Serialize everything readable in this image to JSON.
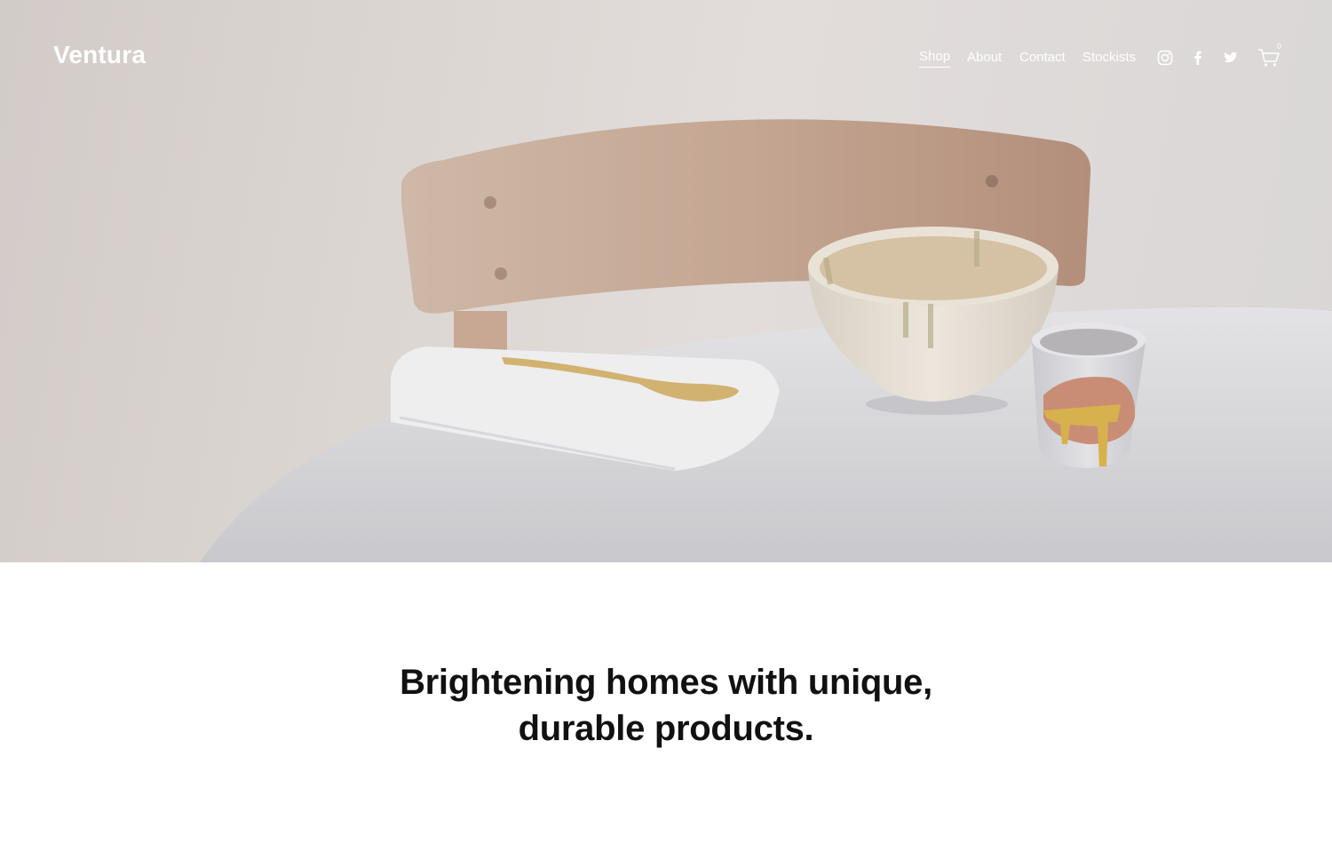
{
  "site": {
    "logo": "Ventura"
  },
  "nav": {
    "links": [
      {
        "label": "Shop",
        "active": true
      },
      {
        "label": "About",
        "active": false
      },
      {
        "label": "Contact",
        "active": false
      },
      {
        "label": "Stockists",
        "active": false
      }
    ],
    "social": [
      "instagram-icon",
      "facebook-icon",
      "twitter-icon"
    ],
    "cart": {
      "icon": "cart-icon",
      "count": "0"
    }
  },
  "hero": {
    "image": "chair-table-ceramics-photo"
  },
  "intro": {
    "headline_line1": "Brightening homes with unique,",
    "headline_line2": "durable products."
  },
  "colors": {
    "nav_text": "#ffffff",
    "headline": "#111111",
    "background": "#ffffff"
  }
}
